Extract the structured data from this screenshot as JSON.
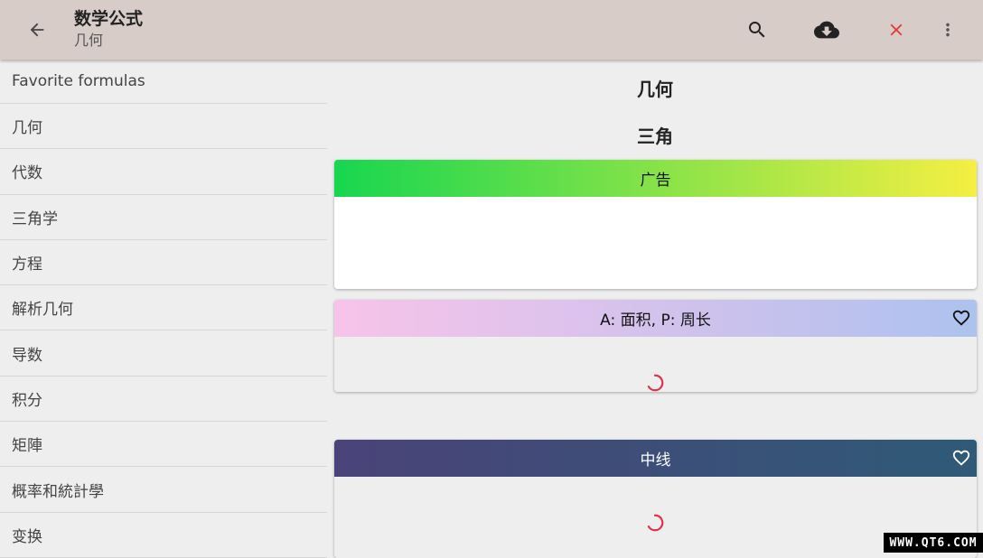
{
  "appbar": {
    "title": "数学公式",
    "subtitle": "几何",
    "back_icon": "arrow-back-icon",
    "actions": [
      "search-icon",
      "cloud-download-icon",
      "close-icon",
      "more-vert-icon"
    ],
    "close_color": "#e53935"
  },
  "sidebar": {
    "items": [
      {
        "label": "Favorite formulas"
      },
      {
        "label": "几何"
      },
      {
        "label": "代数"
      },
      {
        "label": "三角学"
      },
      {
        "label": "方程"
      },
      {
        "label": "解析几何"
      },
      {
        "label": "导数"
      },
      {
        "label": "积分"
      },
      {
        "label": "矩陣"
      },
      {
        "label": "概率和統計學"
      },
      {
        "label": "变换"
      }
    ]
  },
  "main": {
    "section_title": "几何",
    "subsection_title": "三角",
    "ad_card": {
      "label": "广告",
      "gradient": [
        "#17d64f",
        "#f5ef42"
      ]
    },
    "cards": [
      {
        "label": "A: 面积, P: 周长",
        "gradient": [
          "#f8c3ea",
          "#adc2ee"
        ],
        "text_color": "#111111"
      },
      {
        "label": "中线",
        "gradient": [
          "#4a4379",
          "#2f5a77"
        ],
        "text_color": "#ffffff"
      }
    ],
    "spinner_color": "#e0314d"
  },
  "watermark": "WWW.QT6.COM"
}
